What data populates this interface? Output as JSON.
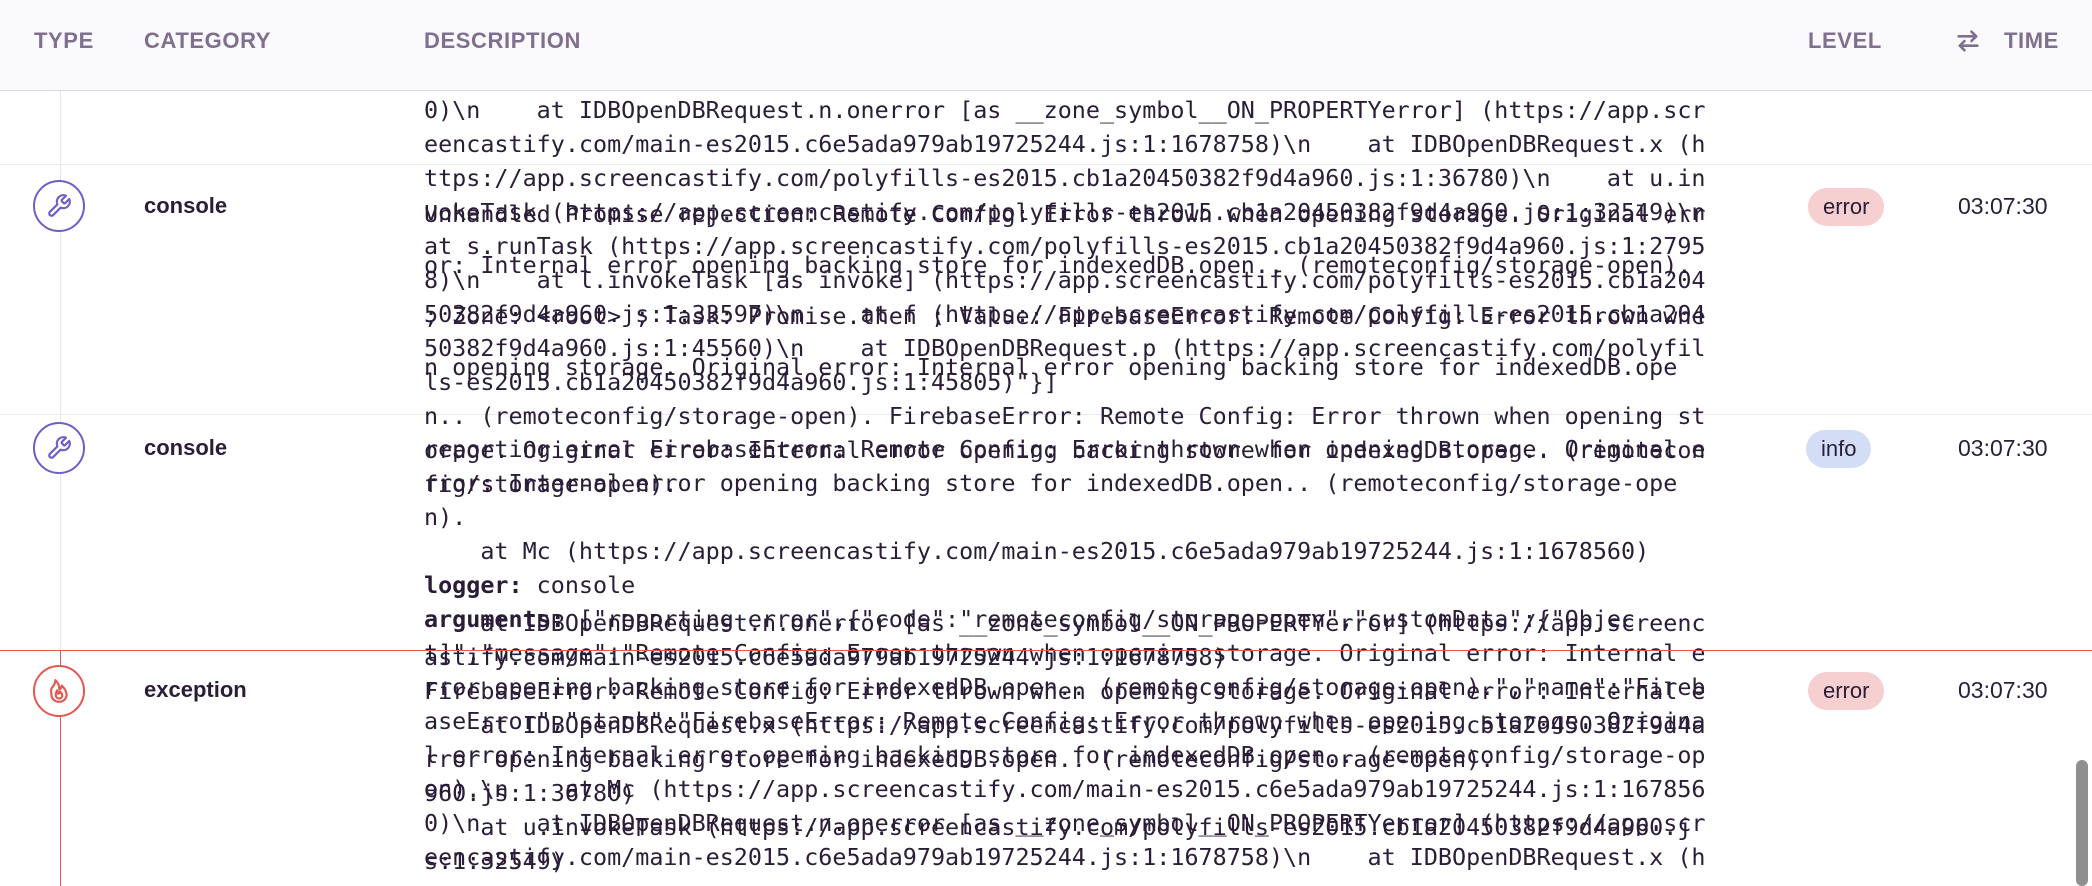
{
  "header": {
    "type": "TYPE",
    "category": "CATEGORY",
    "description": "DESCRIPTION",
    "level": "LEVEL",
    "time": "TIME",
    "sort_icon": "swap-arrows-icon"
  },
  "colors": {
    "accent_purple": "#6c5fc7",
    "error_red": "#e5574f",
    "error_badge_bg": "#f6cfd0",
    "info_badge_bg": "#d3ddf5",
    "header_text": "#80708f"
  },
  "rows": [
    {
      "icon": "wrench-icon",
      "category": "console",
      "level": "error",
      "time": "03:07:30"
    },
    {
      "icon": "wrench-icon",
      "category": "console",
      "level": "info",
      "time": "03:07:30"
    },
    {
      "icon": "fire-icon",
      "category": "exception",
      "level": "error",
      "time": "03:07:30"
    }
  ],
  "desc_layer_a": [
    "0)\\n    at IDBOpenDBRequest.n.onerror [as __zone_symbol__ON_PROPERTYerror] (https://app.scr",
    "eencastify.com/main-es2015.c6e5ada979ab19725244.js:1:1678758)\\n    at IDBOpenDBRequest.x (h",
    "ttps://app.screencastify.com/polyfills-es2015.cb1a20450382f9d4a960.js:1:36780)\\n    at u.in",
    "vokeTask (https://app.screencastify.com/polyfills-es2015.cb1a20450382f9d4a960.js:1:32549)\\n",
    "at s.runTask (https://app.screencastify.com/polyfills-es2015.cb1a20450382f9d4a960.js:1:2795",
    "8)\\n    at l.invokeTask [as invoke] (https://app.screencastify.com/polyfills-es2015.cb1a204",
    "50382f9d4a960.js:1:33597)\\n    at f (https://app.screencastify.com/polyfills-es2015.cb1a204",
    "50382f9d4a960.js:1:45560)\\n    at IDBOpenDBRequest.p (https://app.screencastify.com/polyfil",
    "ls-es2015.cb1a20450382f9d4a960.js:1:45805)\"}]",
    "n.. (remoteconfig/storage-open). FirebaseError: Remote Config: Error thrown when opening st",
    "orage. Original error: Internal error opening backing store for indexedDB.open.. (remotecon",
    "fig/storage-open)."
  ],
  "desc_layer_b": [
    "Unhandled Promise rejection: Remote Config: Error thrown when opening storage. Original err",
    "or: Internal error opening backing store for indexedDB.open.. (remoteconfig/storage-open).",
    "; Zone: <root> ; Task: Promise.then ; Value: FirebaseError: Remote Config: Error thrown whe",
    "n opening storage. Original error: Internal error opening backing store for indexedDB.ope"
  ],
  "desc_layer_c": {
    "lines_before": [
      "reporting error FirebaseError: Remote Config: Error thrown when opening storage. Original e",
      "rror: Internal error opening backing store for indexedDB.open.. (remoteconfig/storage-ope",
      "n).",
      "    at Mc (https://app.screencastify.com/main-es2015.c6e5ada979ab19725244.js:1:1678560)"
    ],
    "logger_label": "logger:",
    "logger_value": " console",
    "arguments_label": "arguments:",
    "arguments_value": " [\"reporting error\",{\"code\":\"remoteconfig/storage-open\",\"customData\":{\"Objec",
    "lines_after": [
      "t]\",\"message\":\"Remote Config: Error thrown when opening storage. Original error: Internal e",
      "rror opening backing store for indexedDB.open.. (remoteconfig/storage-open).\",\"name\":\"Fireb",
      "aseError\",\"stack\":\"FirebaseError: Remote Config: Error thrown when opening storage. Origina",
      "l error: Internal error opening backing store for indexedDB.open.. (remoteconfig/storage-op",
      "en).\\n    at Mc (https://app.screencastify.com/main-es2015.c6e5ada979ab19725244.js:1:167856",
      "0)\\n    at IDBOpenDBRequest.n.onerror [as __zone_symbol__ON_PROPERTYerror] (https://app.scr",
      "eencastify.com/main-es2015.c6e5ada979ab19725244.js:1:1678758)\\n    at IDBOpenDBRequest.x (h"
    ]
  },
  "desc_layer_d": [
    "    at IDBOpenDBRequest.n.onerror [as __zone_symbol__ON_PROPERTYerror] (https://app.screenc",
    "astify.com/main-es2015.c6e5ada979ab19725244.js:1:1678758)",
    "FirebaseError: Remote Config: Error thrown when opening storage. Original error: Internal e",
    "    at IDBOpenDBRequest.x (https://app.screencastify.com/polyfills-es2015.cb1a20450382f9d4a",
    "rror opening backing store for indexedDB.open.. (remoteconfig/storage-open).",
    "960.js:1:36780)",
    "    at u.invokeTask (https://app.screencastify.com/polyfills-es2015.cb1a20450382f9d4a960.j",
    "s:1:32549)"
  ]
}
